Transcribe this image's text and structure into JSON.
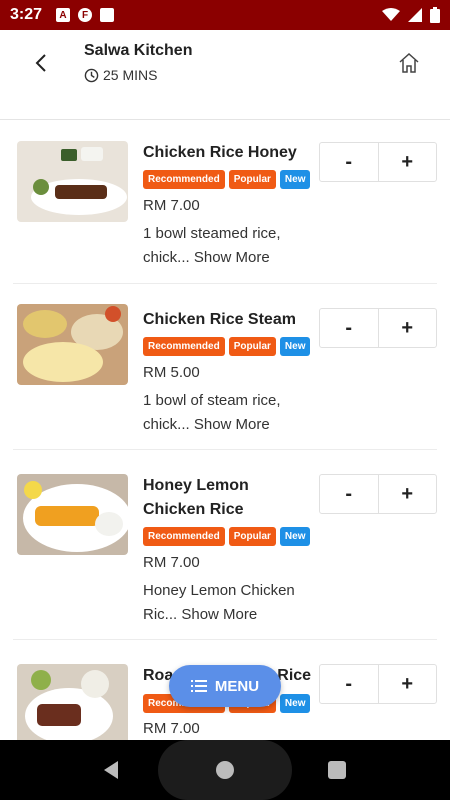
{
  "status_bar": {
    "time": "3:27"
  },
  "header": {
    "title": "Salwa Kitchen",
    "delivery_time": "25 MINS"
  },
  "items": [
    {
      "name": "Chicken Rice Honey",
      "badges": [
        "Recommended",
        "Popular",
        "New"
      ],
      "price": "RM 7.00",
      "description": "1 bowl steamed rice, chick...",
      "show_more": "Show More",
      "minus": "-",
      "plus": "+"
    },
    {
      "name": "Chicken Rice Steam",
      "badges": [
        "Recommended",
        "Popular",
        "New"
      ],
      "price": "RM 5.00",
      "description": "1 bowl of steam rice, chick...",
      "show_more": "Show More",
      "minus": "-",
      "plus": "+"
    },
    {
      "name": "Honey Lemon Chicken Rice",
      "badges": [
        "Recommended",
        "Popular",
        "New"
      ],
      "price": "RM 7.00",
      "description": "Honey Lemon Chicken Ric...",
      "show_more": "Show More",
      "minus": "-",
      "plus": "+"
    },
    {
      "name": "Roasted Chicken Rice",
      "badges": [
        "Recommended",
        "Popular",
        "New"
      ],
      "price": "RM 7.00",
      "minus": "-",
      "plus": "+"
    }
  ],
  "menu_button": {
    "label": "MENU",
    "icon": "list-icon"
  },
  "colors": {
    "status_bar": "#8b0000",
    "badge_orange": "#f05a14",
    "badge_blue": "#1e90e6",
    "menu_button": "#5b8fe8"
  }
}
